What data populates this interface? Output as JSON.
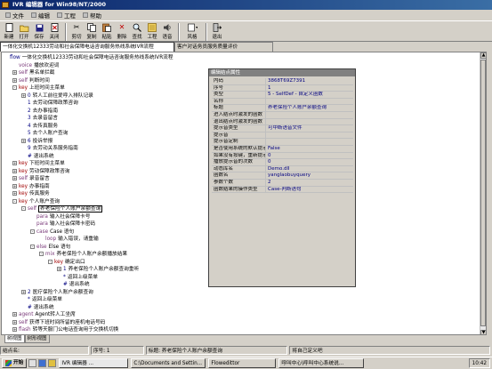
{
  "window": {
    "title": "IVR 编辑器 for Win98/NT/2000"
  },
  "menu": [
    "文件",
    "编辑",
    "工程",
    "帮助"
  ],
  "toolbar": [
    {
      "label": "新建",
      "icon": "new-file-icon"
    },
    {
      "label": "打开",
      "icon": "open-folder-icon"
    },
    {
      "label": "保存",
      "icon": "save-icon"
    },
    {
      "label": "关闭",
      "icon": "close-doc-icon"
    },
    {
      "label": "剪切",
      "icon": "cut-icon"
    },
    {
      "label": "复制",
      "icon": "copy-icon"
    },
    {
      "label": "粘贴",
      "icon": "paste-icon"
    },
    {
      "label": "删除",
      "icon": "delete-icon"
    },
    {
      "label": "查找",
      "icon": "find-icon"
    },
    {
      "label": "工程",
      "icon": "project-icon"
    },
    {
      "label": "语音",
      "icon": "voice-icon"
    },
    {
      "label": "风格",
      "icon": "style-icon"
    },
    {
      "label": "退出",
      "icon": "exit-icon"
    }
  ],
  "tabs": [
    {
      "label": "一体化交换机12333劳动和社会保障电话咨询服务热线系统IVR流程",
      "active": true
    },
    {
      "label": "客户对话务员服务质量评价",
      "active": false
    }
  ],
  "tree": [
    {
      "indent": 0,
      "kw": "flow",
      "text": "一体化交换机12333劳动和社会保障电话咨询服务热线系统IVR流程",
      "color": "blue",
      "exp": ""
    },
    {
      "indent": 1,
      "kw": "voice",
      "text": "播放欢迎词",
      "color": "purple",
      "exp": ""
    },
    {
      "indent": 1,
      "kw": "self",
      "text": "黑名单拦截",
      "color": "purple",
      "exp": "+"
    },
    {
      "indent": 1,
      "kw": "self",
      "text": "判断时间",
      "color": "purple",
      "exp": "+"
    },
    {
      "indent": 1,
      "kw": "key",
      "text": "上班时间主菜单",
      "color": "red",
      "exp": "-"
    },
    {
      "indent": 2,
      "kw": "0",
      "text": "转人工前往爱呼入排队记录",
      "color": "blue",
      "exp": "+"
    },
    {
      "indent": 2,
      "kw": "1",
      "text": "去劳动保障政策咨询",
      "color": "blue",
      "exp": ""
    },
    {
      "indent": 2,
      "kw": "2",
      "text": "去办事指南",
      "color": "blue",
      "exp": ""
    },
    {
      "indent": 2,
      "kw": "3",
      "text": "去录音留言",
      "color": "blue",
      "exp": ""
    },
    {
      "indent": 2,
      "kw": "4",
      "text": "去传真服务",
      "color": "blue",
      "exp": ""
    },
    {
      "indent": 2,
      "kw": "5",
      "text": "去个人账户查询",
      "color": "blue",
      "exp": ""
    },
    {
      "indent": 2,
      "kw": "6",
      "text": "投诉举报",
      "color": "blue",
      "exp": "+"
    },
    {
      "indent": 2,
      "kw": "9",
      "text": "去劳动关系服务指南",
      "color": "blue",
      "exp": ""
    },
    {
      "indent": 2,
      "kw": "#",
      "text": "退出系统",
      "color": "blue",
      "exp": ""
    },
    {
      "indent": 1,
      "kw": "key",
      "text": "下班时间主菜单",
      "color": "red",
      "exp": "+"
    },
    {
      "indent": 1,
      "kw": "key",
      "text": "劳动保障政策咨询",
      "color": "red",
      "exp": "+"
    },
    {
      "indent": 1,
      "kw": "self",
      "text": "录音留言",
      "color": "purple",
      "exp": "+"
    },
    {
      "indent": 1,
      "kw": "key",
      "text": "办事指南",
      "color": "red",
      "exp": "+"
    },
    {
      "indent": 1,
      "kw": "key",
      "text": "传真服务",
      "color": "red",
      "exp": "+"
    },
    {
      "indent": 1,
      "kw": "key",
      "text": "个人账户查询",
      "color": "red",
      "exp": "-"
    },
    {
      "indent": 2,
      "kw": "self",
      "text": "养老保险个人账户余额查询",
      "color": "purple",
      "exp": "-",
      "highlight": true
    },
    {
      "indent": 3,
      "kw": "para",
      "text": "输入社会保障卡号",
      "color": "purple",
      "exp": ""
    },
    {
      "indent": 3,
      "kw": "para",
      "text": "输入社会保障卡密码",
      "color": "purple",
      "exp": ""
    },
    {
      "indent": 3,
      "kw": "case",
      "text": "Case 语句",
      "color": "purple",
      "exp": "-"
    },
    {
      "indent": 4,
      "kw": "loop",
      "text": "输入错误，请重输",
      "color": "purple",
      "exp": ""
    },
    {
      "indent": 3,
      "kw": "else",
      "text": "Else 语句",
      "color": "purple",
      "exp": "-"
    },
    {
      "indent": 4,
      "kw": "mix",
      "text": "养老保险个人账户余额播放结果",
      "color": "purple",
      "exp": "-"
    },
    {
      "indent": 5,
      "kw": "key",
      "text": "确定出口",
      "color": "red",
      "exp": "-"
    },
    {
      "indent": 6,
      "kw": "1",
      "text": "养老保险个人账户余额查询重听",
      "color": "blue",
      "exp": "+"
    },
    {
      "indent": 6,
      "kw": "*",
      "text": "返回上级菜单",
      "color": "blue",
      "exp": ""
    },
    {
      "indent": 6,
      "kw": "#",
      "text": "退出系统",
      "color": "blue",
      "exp": ""
    },
    {
      "indent": 2,
      "kw": "2",
      "text": "医疗保险个人账户余额查询",
      "color": "blue",
      "exp": "+"
    },
    {
      "indent": 2,
      "kw": "*",
      "text": "返回上级菜单",
      "color": "blue",
      "exp": ""
    },
    {
      "indent": 2,
      "kw": "#",
      "text": "退出系统",
      "color": "blue",
      "exp": ""
    },
    {
      "indent": 1,
      "kw": "agent",
      "text": "Agent转人工坐席",
      "color": "purple",
      "exp": "+"
    },
    {
      "indent": 1,
      "kw": "self",
      "text": "获得下班时间所留的座机电话号码",
      "color": "purple",
      "exp": "+"
    },
    {
      "indent": 1,
      "kw": "flash",
      "text": "转等天服门公电话查询用于交换机切换",
      "color": "purple",
      "exp": "+"
    }
  ],
  "props": {
    "title": "编辑结点属性",
    "rows": [
      {
        "k": "内码",
        "v": "3868T69Z7391"
      },
      {
        "k": "序号",
        "v": "1"
      },
      {
        "k": "类型",
        "v": "5 - SelfDef - 自定义函数"
      },
      {
        "k": "名称",
        "v": ""
      },
      {
        "k": "标题",
        "v": "养老保险个人账户余额查询"
      },
      {
        "k": "进入结点时激发的函数",
        "v": ""
      },
      {
        "k": "退出结点时激发的函数",
        "v": ""
      },
      {
        "k": "提示音类型",
        "v": "可中断语音文件"
      },
      {
        "k": "提示音",
        "v": ""
      },
      {
        "k": "提示音定制",
        "v": ""
      },
      {
        "k": "是否使用系统的默认提示音播放",
        "v": "False"
      },
      {
        "k": "如果没有按键，重新提示音的间隔(秒)",
        "v": "0"
      },
      {
        "k": "播放提示音的次数",
        "v": "0"
      },
      {
        "k": "动态库名",
        "v": "Demo.dll"
      },
      {
        "k": "函数名",
        "v": "yanglaobuyquery"
      },
      {
        "k": "参数个数",
        "v": "2"
      },
      {
        "k": "函数结果的操作类型",
        "v": "Case-判断语句"
      }
    ]
  },
  "bottom_tabs": [
    {
      "label": "树视图",
      "active": true
    },
    {
      "label": "树形视图",
      "active": false
    }
  ],
  "status": {
    "name_label": "结点名:",
    "seq_label": "序号: 1",
    "title_label": "标题: 养老保险个人账户余额查询",
    "hint": "将自己定义吧"
  },
  "taskbar": {
    "start": "开始",
    "tasks": [
      "IVR 编辑器 ...",
      "C:\\Documents and Settin...",
      "Flowedittor",
      "呼叫中心\\呼叫中心系统说..."
    ],
    "clock": "10:42"
  }
}
